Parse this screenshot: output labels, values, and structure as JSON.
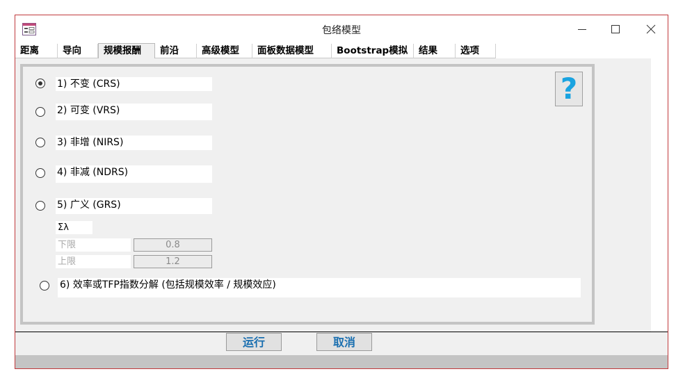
{
  "window": {
    "title": "包络模型",
    "border_color": "#c0393c",
    "controls": [
      "minimize-icon",
      "maximize-icon",
      "close-icon"
    ]
  },
  "tabs": [
    {
      "label": "距离",
      "active": false
    },
    {
      "label": "导向",
      "active": false
    },
    {
      "label": "规模报酬",
      "active": true
    },
    {
      "label": "前沿",
      "active": false
    },
    {
      "label": "高级模型",
      "active": false
    },
    {
      "label": "面板数据模型",
      "active": false
    },
    {
      "label": "Bootstrap模拟",
      "active": false
    },
    {
      "label": "结果",
      "active": false
    },
    {
      "label": "选项",
      "active": false
    }
  ],
  "options": [
    {
      "label": "1) 不变 (CRS)",
      "selected": true
    },
    {
      "label": "2) 可变 (VRS)",
      "selected": false
    },
    {
      "label": "3) 非增 (NIRS)",
      "selected": false
    },
    {
      "label": "4) 非减 (NDRS)",
      "selected": false
    },
    {
      "label": "5) 广义 (GRS)",
      "selected": false
    },
    {
      "label": "6) 效率或TFP指数分解 (包括规模效率 / 规模效应)",
      "selected": false
    }
  ],
  "grs": {
    "sum_label": "Σλ",
    "lower_label": "下限",
    "lower_value": "0.8",
    "upper_label": "上限",
    "upper_value": "1.2"
  },
  "help": {
    "glyph": "?",
    "color": "#1aa3e0"
  },
  "buttons": {
    "run": "运行",
    "cancel": "取消",
    "text_color": "#1a6fb0"
  }
}
